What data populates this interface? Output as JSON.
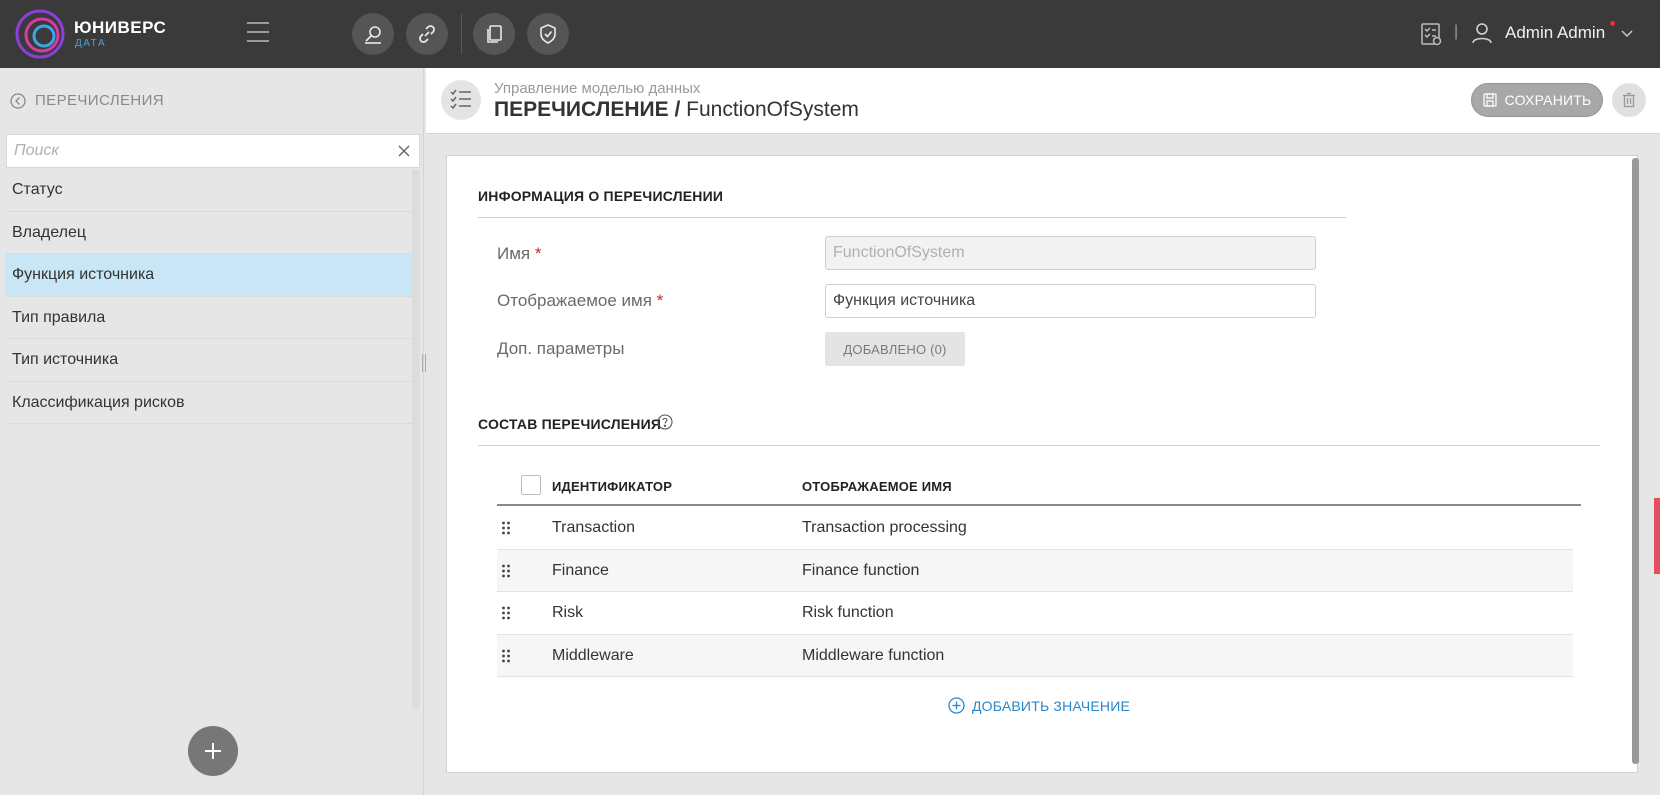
{
  "app": {
    "brand_name": "ЮНИВЕРС",
    "brand_sub": "ДАТА",
    "accent_color": "#3aa8e8",
    "user_name": "Admin Admin"
  },
  "toolbar": {
    "icons": [
      "search-data-icon",
      "link-icon",
      "copy-icon",
      "shield-icon"
    ]
  },
  "sidebar": {
    "back_label": "ПЕРЕЧИСЛЕНИЯ",
    "search_placeholder": "Поиск",
    "items": [
      {
        "label": "Статус",
        "active": false
      },
      {
        "label": "Владелец",
        "active": false
      },
      {
        "label": "Функция источника",
        "active": true
      },
      {
        "label": "Тип правила",
        "active": false
      },
      {
        "label": "Тип источника",
        "active": false
      },
      {
        "label": "Классификация рисков",
        "active": false
      }
    ],
    "add_button": "+"
  },
  "header": {
    "breadcrumb": "Управление моделью данных",
    "title_type": "ПЕРЕЧИСЛЕНИЕ /",
    "title_name": "FunctionOfSystem",
    "save_label": "СОХРАНИТЬ"
  },
  "info_section": {
    "title": "ИНФОРМАЦИЯ О ПЕРЕЧИСЛЕНИИ",
    "name_label": "Имя",
    "name_value": "FunctionOfSystem",
    "display_label": "Отображаемое имя",
    "display_value": "Функция источника",
    "params_label": "Доп. параметры",
    "params_button": "ДОБАВЛЕНО (0)",
    "required_mark": "*"
  },
  "composition": {
    "title": "СОСТАВ ПЕРЕЧИСЛЕНИЯ",
    "columns": [
      "ИДЕНТИФИКАТОР",
      "ОТОБРАЖАЕМОЕ ИМЯ"
    ],
    "rows": [
      {
        "id": "Transaction",
        "display": "Transaction processing"
      },
      {
        "id": "Finance",
        "display": "Finance function"
      },
      {
        "id": "Risk",
        "display": "Risk function"
      },
      {
        "id": "Middleware",
        "display": "Middleware function"
      }
    ],
    "add_label": "ДОБАВИТЬ ЗНАЧЕНИЕ"
  }
}
